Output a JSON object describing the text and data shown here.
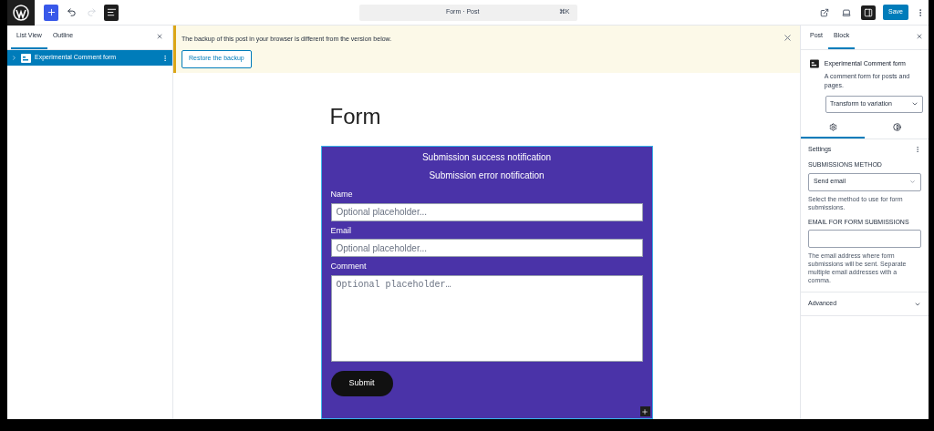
{
  "top_bar": {
    "tools": [
      {
        "kind": "inserter"
      },
      {
        "kind": "undo",
        "disabled": false
      },
      {
        "kind": "redo",
        "disabled": true
      },
      {
        "kind": "document_overview",
        "pressed": true
      }
    ],
    "command_bar": {
      "title": "Form · Post",
      "shortcut": "⌘K"
    },
    "actions": [
      {
        "kind": "view",
        "pressed": false
      },
      {
        "kind": "preview",
        "pressed": false
      },
      {
        "kind": "settings",
        "pressed": true
      }
    ],
    "save": "Save"
  },
  "list_view": {
    "tabs": [
      {
        "label": "List View",
        "selected": true
      },
      {
        "label": "Outline",
        "selected": false
      }
    ],
    "items": [
      {
        "label": "Experimental Comment form",
        "selected": true,
        "expanded": false
      }
    ]
  },
  "notice": {
    "message": "The backup of this post in your browser is different from the version below.",
    "action": "Restore the backup"
  },
  "editor": {
    "title": "Form",
    "notifications": [
      "Submission success notification",
      "Submission error notification"
    ],
    "fields": [
      {
        "kind": "input",
        "label": "Name",
        "placeholder": "Optional placeholder..."
      },
      {
        "kind": "input",
        "label": "Email",
        "placeholder": "Optional placeholder..."
      },
      {
        "kind": "textarea",
        "label": "Comment",
        "placeholder": "Optional placeholder…"
      }
    ],
    "submit": "Submit"
  },
  "sidebar": {
    "tabs": [
      {
        "label": "Post",
        "selected": false
      },
      {
        "label": "Block",
        "selected": true
      }
    ],
    "block": {
      "name": "Experimental Comment form",
      "description": "A comment form for posts and pages.",
      "transform": "Transform to variation"
    },
    "inspector_tabs": [
      {
        "kind": "settings",
        "selected": true
      },
      {
        "kind": "styles",
        "selected": false
      }
    ],
    "settings": {
      "title": "Settings",
      "fields": [
        {
          "kind": "select",
          "label": "SUBMISSIONS METHOD",
          "value": "Send email",
          "help": "Select the method to use for form submissions."
        },
        {
          "kind": "text",
          "label": "EMAIL FOR FORM SUBMISSIONS",
          "help": "The email address where form submissions will be sent. Separate multiple email addresses with a comma."
        }
      ]
    },
    "advanced": {
      "label": "Advanced",
      "expanded": false
    }
  }
}
